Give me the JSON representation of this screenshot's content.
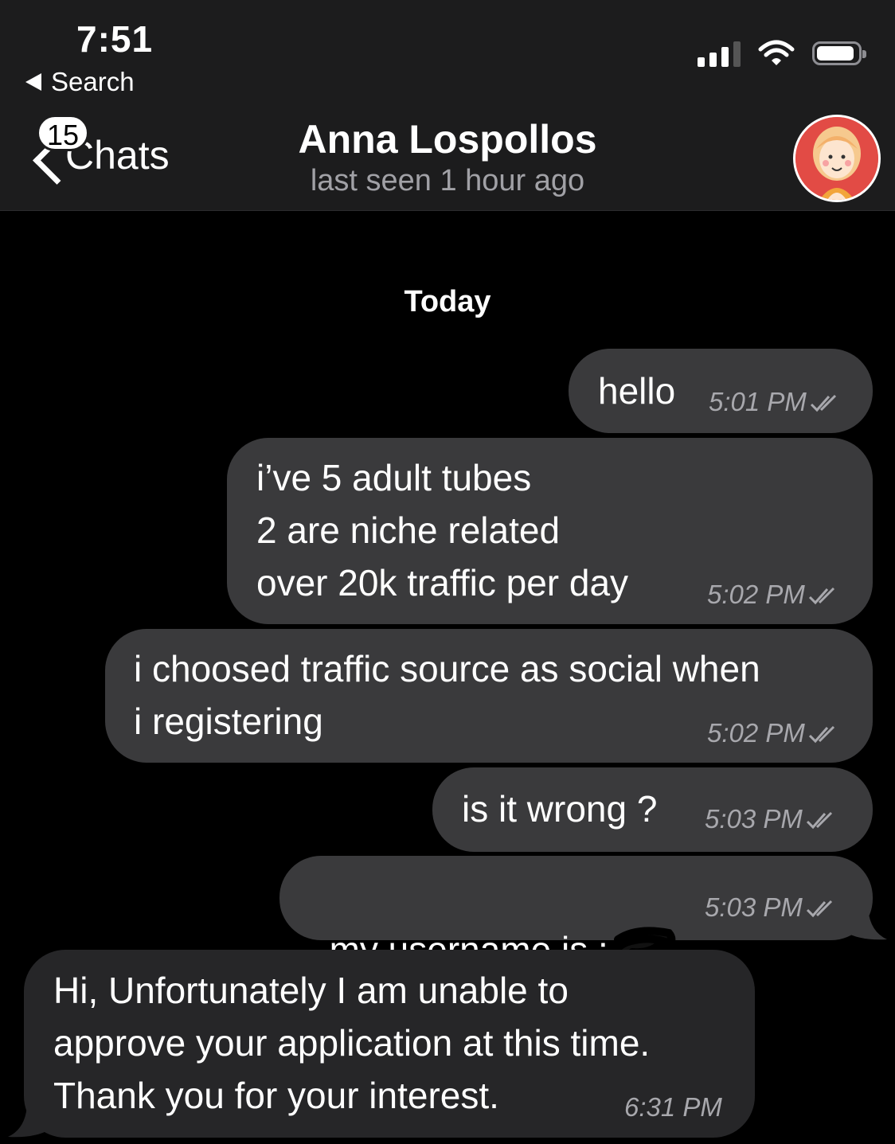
{
  "status_bar": {
    "time": "7:51",
    "back_app_label": "Search"
  },
  "nav": {
    "back_label": "Chats",
    "unread_count": "15",
    "contact_name": "Anna Lospollos",
    "contact_status": "last seen 1 hour ago"
  },
  "conversation": {
    "date_separator": "Today",
    "messages": [
      {
        "direction": "outgoing",
        "text": "hello",
        "time": "5:01 PM",
        "read": true
      },
      {
        "direction": "outgoing",
        "text": "i’ve 5 adult tubes\n2 are niche related\nover 20k traffic per day",
        "time": "5:02 PM",
        "read": true
      },
      {
        "direction": "outgoing",
        "text": "i choosed traffic source as social when\ni registering",
        "time": "5:02 PM",
        "read": true
      },
      {
        "direction": "outgoing",
        "text": "is it wrong ?",
        "time": "5:03 PM",
        "read": true
      },
      {
        "direction": "outgoing",
        "text": "my username is :",
        "time": "5:03 PM",
        "read": true,
        "redacted": true
      },
      {
        "direction": "incoming",
        "text": "Hi, Unfortunately I am unable to\napprove your application at this time.\nThank you for your interest.",
        "time": "6:31 PM"
      }
    ]
  },
  "battery_level": 0.85,
  "colors": {
    "outgoing_bubble": "#3a3a3c",
    "incoming_bubble": "#262628",
    "header_bg": "#1c1c1d",
    "avatar_bg": "#e24b45"
  }
}
